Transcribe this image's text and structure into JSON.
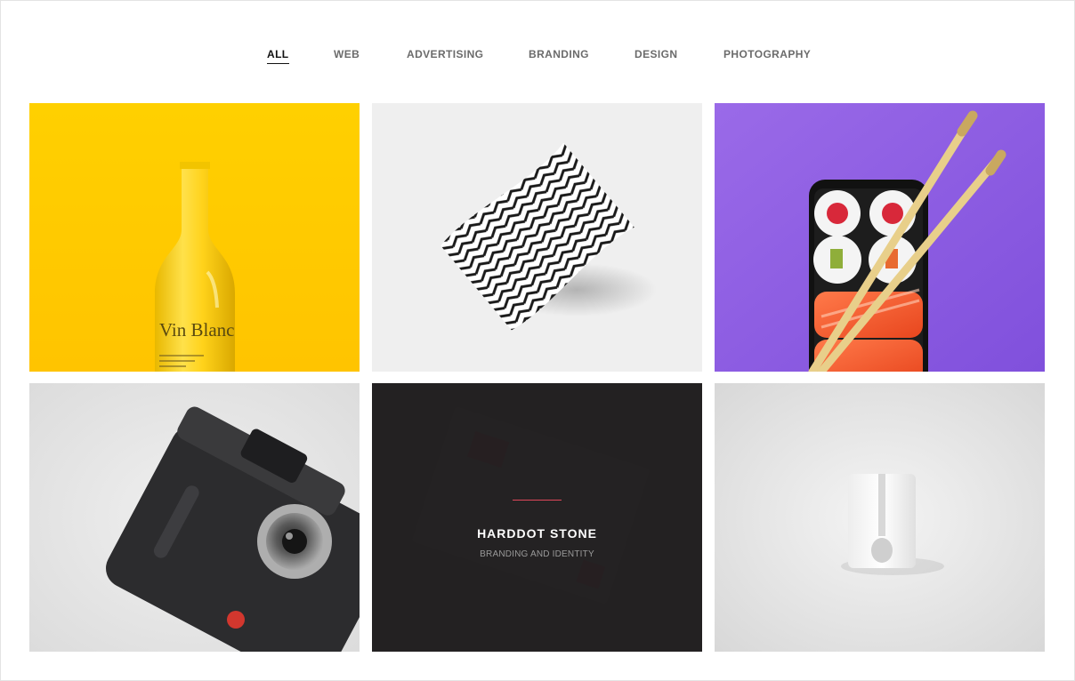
{
  "filters": [
    {
      "label": "ALL",
      "active": true
    },
    {
      "label": "WEB",
      "active": false
    },
    {
      "label": "ADVERTISING",
      "active": false
    },
    {
      "label": "BRANDING",
      "active": false
    },
    {
      "label": "DESIGN",
      "active": false
    },
    {
      "label": "PHOTOGRAPHY",
      "active": false
    }
  ],
  "portfolio": {
    "items": [
      {
        "image": "yellow-wine-bottle",
        "bottle_label": "Vin Blanc"
      },
      {
        "image": "zigzag-pattern-paper"
      },
      {
        "image": "sushi-phone-chopsticks"
      },
      {
        "image": "camera-device"
      },
      {
        "image": "hovered-project",
        "title": "HARDDOT STONE",
        "category": "BRANDING AND IDENTITY",
        "accent": "#e0475b"
      },
      {
        "image": "white-block-object"
      }
    ]
  },
  "colors": {
    "yellow": "#ffcc00",
    "purple": "#9062e6",
    "overlay": "#201e1f",
    "active_filter": "#111111",
    "filter": "#6b6b6b"
  }
}
